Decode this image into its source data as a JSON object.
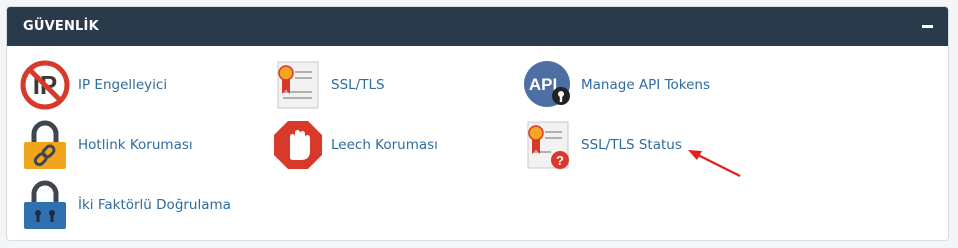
{
  "panel": {
    "title": "GÜVENLİK",
    "collapse_icon": "minus-icon"
  },
  "items": [
    {
      "label": "IP Engelleyici",
      "icon": "ip-blocker-icon"
    },
    {
      "label": "SSL/TLS",
      "icon": "ssl-certificate-icon"
    },
    {
      "label": "Manage API Tokens",
      "icon": "api-key-icon"
    },
    {
      "label": "Hotlink Koruması",
      "icon": "lock-link-icon"
    },
    {
      "label": "Leech Koruması",
      "icon": "stop-hand-icon"
    },
    {
      "label": "SSL/TLS Status",
      "icon": "ssl-status-icon"
    },
    {
      "label": "İki Faktörlü Doğrulama",
      "icon": "two-factor-lock-icon"
    }
  ],
  "annotation": {
    "icon": "red-arrow-pointer",
    "color": "#e0211d"
  },
  "colors": {
    "header_bg": "#293a4a",
    "link": "#2e6ba0"
  }
}
